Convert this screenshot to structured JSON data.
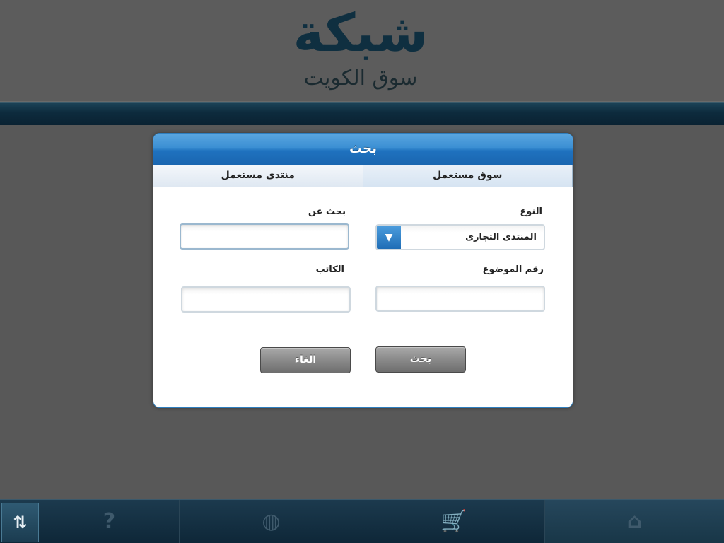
{
  "header": {
    "logo_main": "شبكة",
    "logo_sub": "سوق الكويت"
  },
  "dialog": {
    "title": "بحث",
    "tabs": [
      {
        "label": "سوق مستعمل",
        "active": true
      },
      {
        "label": "منتدى مستعمل",
        "active": false
      }
    ],
    "form": {
      "type_label": "النوع",
      "type_value": "المنتدى التجارى",
      "search_label": "بحث عن",
      "search_value": "",
      "topic_number_label": "رقم الموضوع",
      "topic_number_value": "",
      "author_label": "الكاتب",
      "author_value": ""
    },
    "buttons": {
      "search": "بحث",
      "cancel": "الغاء"
    }
  },
  "toolbar": {
    "items": [
      {
        "icon": "home-icon",
        "glyph": "⌂"
      },
      {
        "icon": "cart-icon",
        "glyph": "🛒"
      },
      {
        "icon": "globe-icon",
        "glyph": "◍"
      },
      {
        "icon": "help-icon",
        "glyph": "?"
      },
      {
        "icon": "sort-icon",
        "glyph": "⇅"
      }
    ]
  },
  "colors": {
    "accent": "#1f72bf",
    "toolbar": "#0e2738",
    "overlay": "#585858"
  }
}
